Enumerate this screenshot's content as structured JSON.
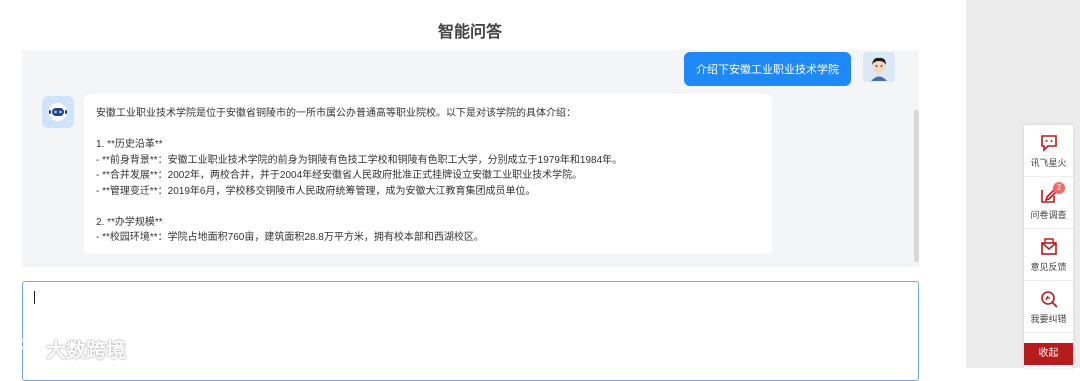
{
  "page": {
    "title": "智能问答"
  },
  "chat": {
    "user_message": "介绍下安徽工业职业技术学院",
    "bot_lines": [
      "安徽工业职业技术学院是位于安徽省铜陵市的一所市属公办普通高等职业院校。以下是对该学院的具体介绍：",
      "",
      "1. **历史沿革**",
      "- **前身背景**：安徽工业职业技术学院的前身为铜陵有色技工学校和铜陵有色职工大学，分别成立于1979年和1984年。",
      "- **合并发展**：2002年，两校合并，并于2004年经安徽省人民政府批准正式挂牌设立安徽工业职业技术学院。",
      "- **管理变迁**：2019年6月，学校移交铜陵市人民政府统筹管理，成为安徽大江教育集团成员单位。",
      "",
      "2. **办学规模**",
      "- **校园环境**：学院占地面积760亩，建筑面积28.8万平方米，拥有校本部和西湖校区。"
    ]
  },
  "input": {
    "value": ""
  },
  "watermark": {
    "text": "大数跨境"
  },
  "toolbar": {
    "items": [
      {
        "label": "讯飞星火",
        "icon": "chat-icon"
      },
      {
        "label": "问卷调查",
        "icon": "edit-icon",
        "badge": "2"
      },
      {
        "label": "意见反馈",
        "icon": "mail-icon"
      },
      {
        "label": "我要纠错",
        "icon": "search-icon"
      }
    ],
    "collapse_label": "收起"
  },
  "colors": {
    "accent": "#1e88f5",
    "brand_red": "#b71c1c"
  }
}
